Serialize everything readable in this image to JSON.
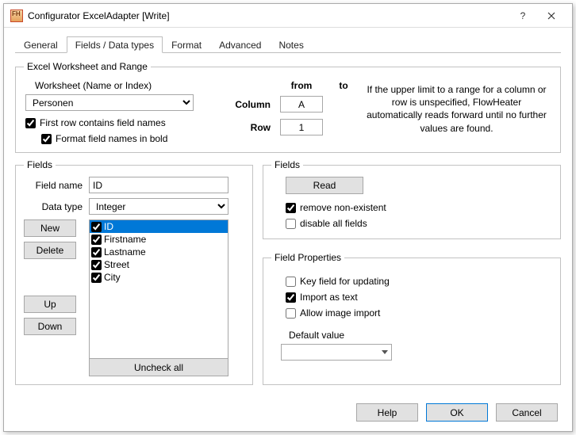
{
  "window": {
    "title": "Configurator ExcelAdapter [Write]"
  },
  "tabs": {
    "items": [
      "General",
      "Fields / Data types",
      "Format",
      "Advanced",
      "Notes"
    ],
    "active_index": 1
  },
  "worksheet_group": {
    "legend": "Excel Worksheet and Range",
    "worksheet_label": "Worksheet (Name or Index)",
    "worksheet_value": "Personen",
    "first_row_label": "First row contains field names",
    "format_bold_label": "Format field names in bold",
    "column_label": "Column",
    "row_label": "Row",
    "from_label": "from",
    "to_label": "to",
    "column_from": "A",
    "row_from": "1",
    "help_text": "If the upper limit to a range for a column or row is unspecified, FlowHeater automatically reads forward until no further values are found."
  },
  "fields_left": {
    "legend": "Fields",
    "fieldname_label": "Field name",
    "fieldname_value": "ID",
    "datatype_label": "Data type",
    "datatype_value": "Integer",
    "new_btn": "New",
    "delete_btn": "Delete",
    "up_btn": "Up",
    "down_btn": "Down",
    "uncheck_btn": "Uncheck all",
    "list": [
      {
        "label": "ID",
        "checked": true,
        "selected": true
      },
      {
        "label": "Firstname",
        "checked": true,
        "selected": false
      },
      {
        "label": "Lastname",
        "checked": true,
        "selected": false
      },
      {
        "label": "Street",
        "checked": true,
        "selected": false
      },
      {
        "label": "City",
        "checked": true,
        "selected": false
      }
    ]
  },
  "fields_read": {
    "legend": "Fields",
    "read_btn": "Read",
    "remove_nonexistent_label": "remove non-existent",
    "disable_all_label": "disable all fields"
  },
  "field_props": {
    "legend": "Field Properties",
    "key_field_label": "Key field for updating",
    "import_text_label": "Import as text",
    "allow_image_label": "Allow image import",
    "default_value_label": "Default value"
  },
  "footer": {
    "help": "Help",
    "ok": "OK",
    "cancel": "Cancel"
  }
}
